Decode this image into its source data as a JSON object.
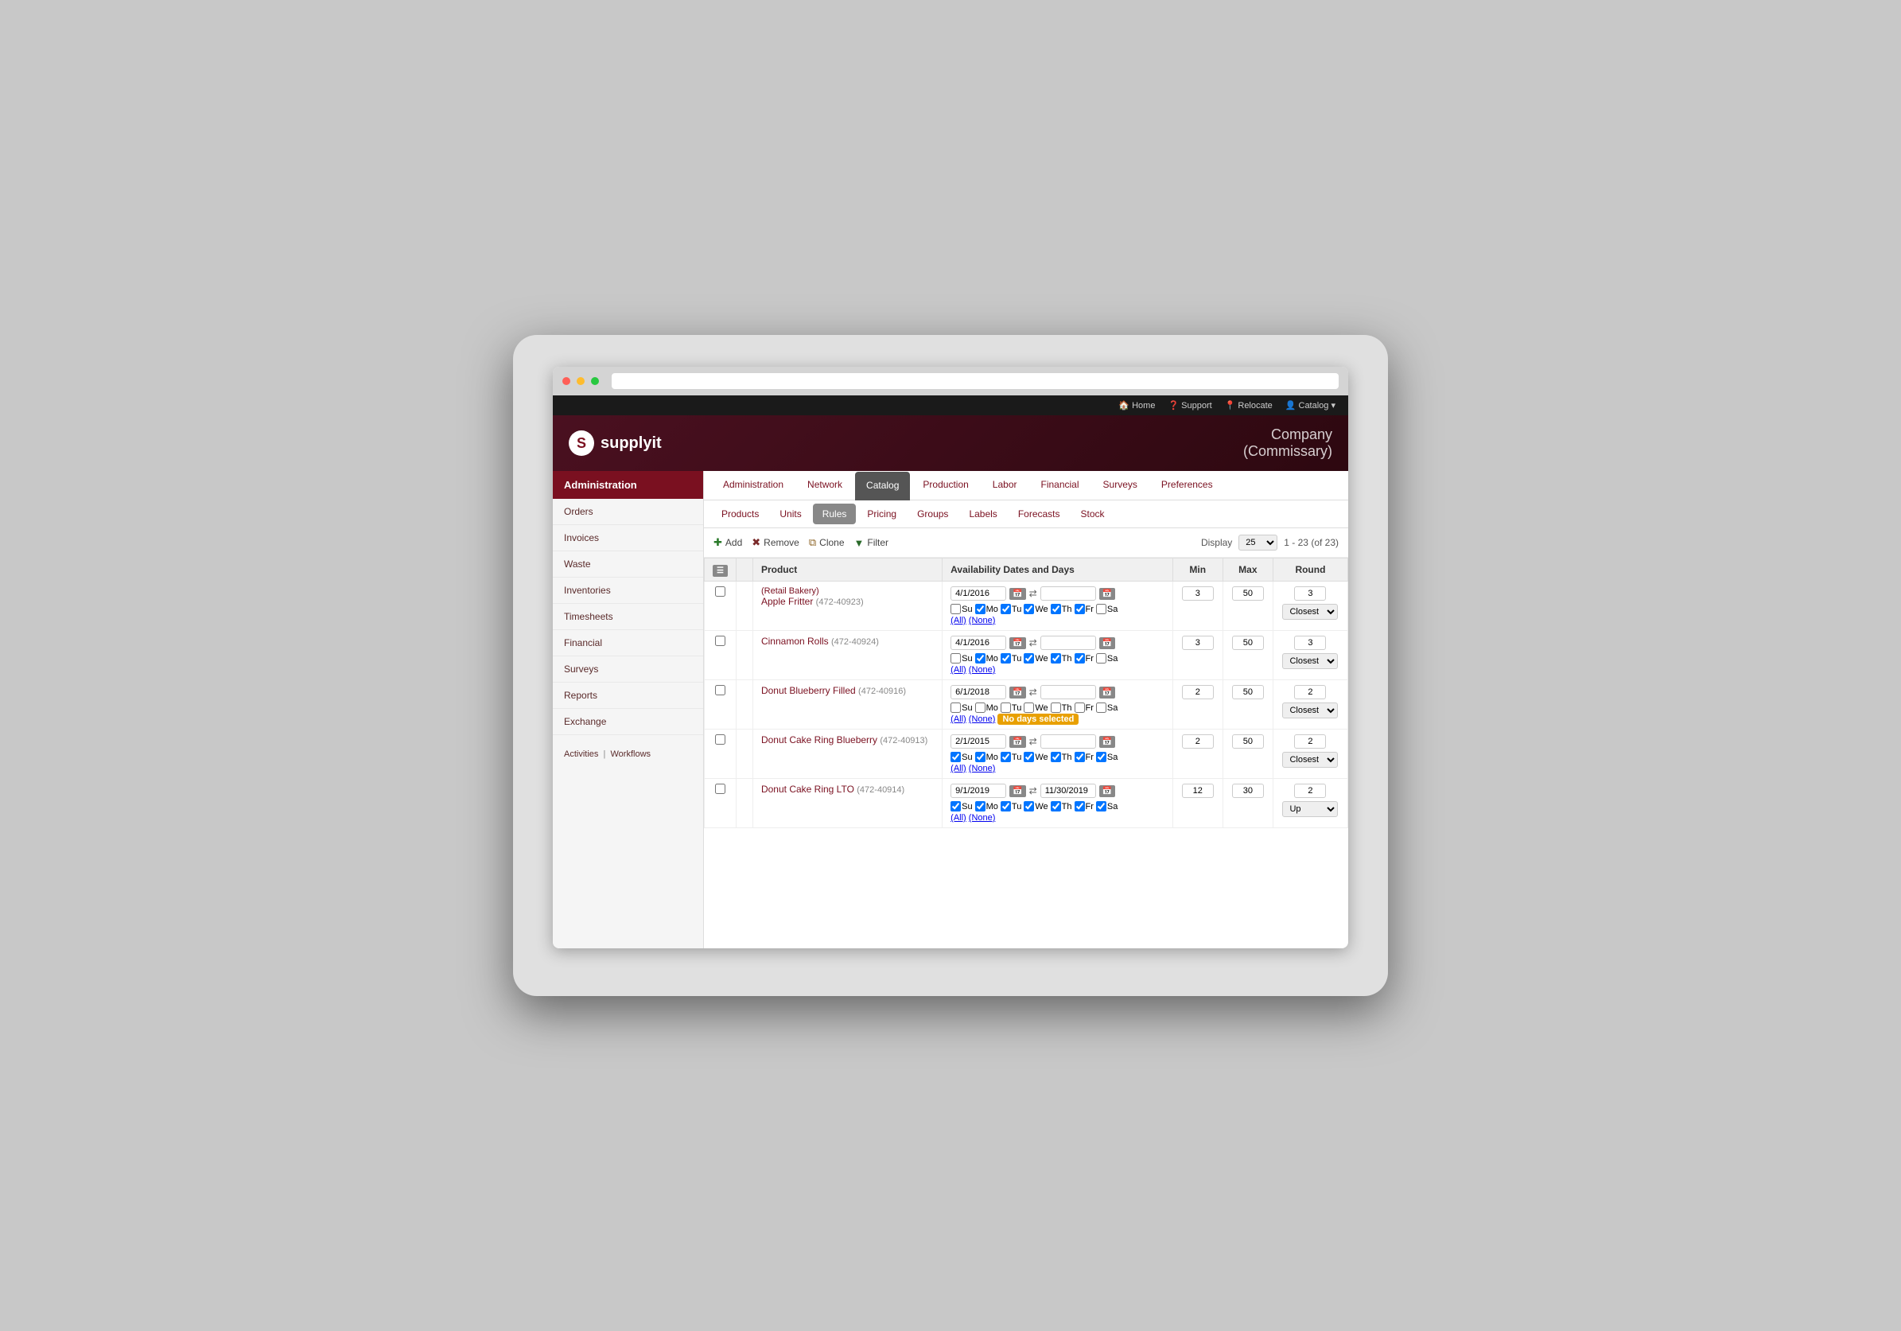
{
  "browser": {
    "dots": [
      "red",
      "yellow",
      "green"
    ]
  },
  "topnav": {
    "items": [
      {
        "label": "Home",
        "icon": "🏠"
      },
      {
        "label": "Support",
        "icon": "❓"
      },
      {
        "label": "Relocate",
        "icon": "📍"
      },
      {
        "label": "Catalog ▾",
        "icon": "👤"
      }
    ]
  },
  "header": {
    "logo_text": "supplyit",
    "company": "Company",
    "subtitle": "(Commissary)"
  },
  "sidebar": {
    "active_item": "Administration",
    "items": [
      {
        "label": "Orders"
      },
      {
        "label": "Invoices"
      },
      {
        "label": "Waste"
      },
      {
        "label": "Inventories"
      },
      {
        "label": "Timesheets"
      },
      {
        "label": "Financial"
      },
      {
        "label": "Surveys"
      },
      {
        "label": "Reports"
      },
      {
        "label": "Exchange"
      }
    ],
    "footer_links": [
      "Activities",
      "Workflows"
    ]
  },
  "tabs": {
    "main": [
      {
        "label": "Administration"
      },
      {
        "label": "Network"
      },
      {
        "label": "Catalog",
        "active": true
      },
      {
        "label": "Production"
      },
      {
        "label": "Labor"
      },
      {
        "label": "Financial"
      },
      {
        "label": "Surveys"
      },
      {
        "label": "Preferences"
      }
    ],
    "sub": [
      {
        "label": "Products"
      },
      {
        "label": "Units"
      },
      {
        "label": "Rules",
        "active": true
      },
      {
        "label": "Pricing"
      },
      {
        "label": "Groups"
      },
      {
        "label": "Labels"
      },
      {
        "label": "Forecasts"
      },
      {
        "label": "Stock"
      }
    ]
  },
  "toolbar": {
    "add_label": "Add",
    "remove_label": "Remove",
    "clone_label": "Clone",
    "filter_label": "Filter",
    "display_label": "Display",
    "display_value": "25",
    "pagination": "1 - 23 (of 23)"
  },
  "table": {
    "headers": [
      "",
      "",
      "Product",
      "Availability Dates and Days",
      "Min",
      "Max",
      "Round"
    ],
    "rows": [
      {
        "id": 1,
        "category": "Retail Bakery",
        "product_name": "Apple Fritter",
        "product_code": "472-40923",
        "date_from": "4/1/2016",
        "date_to": "",
        "min": "3",
        "max": "50",
        "round_val": "3",
        "round_type": "Closest",
        "days": [
          {
            "label": "Su",
            "checked": false
          },
          {
            "label": "Mo",
            "checked": true
          },
          {
            "label": "Tu",
            "checked": true
          },
          {
            "label": "We",
            "checked": true
          },
          {
            "label": "Th",
            "checked": true
          },
          {
            "label": "Fr",
            "checked": true
          },
          {
            "label": "Sa",
            "checked": false
          }
        ],
        "warning": ""
      },
      {
        "id": 2,
        "category": "",
        "product_name": "Cinnamon Rolls",
        "product_code": "472-40924",
        "date_from": "4/1/2016",
        "date_to": "",
        "min": "3",
        "max": "50",
        "round_val": "3",
        "round_type": "Closest",
        "days": [
          {
            "label": "Su",
            "checked": false
          },
          {
            "label": "Mo",
            "checked": true
          },
          {
            "label": "Tu",
            "checked": true
          },
          {
            "label": "We",
            "checked": true
          },
          {
            "label": "Th",
            "checked": true
          },
          {
            "label": "Fr",
            "checked": true
          },
          {
            "label": "Sa",
            "checked": false
          }
        ],
        "warning": ""
      },
      {
        "id": 3,
        "category": "",
        "product_name": "Donut Blueberry Filled",
        "product_code": "472-40916",
        "date_from": "6/1/2018",
        "date_to": "",
        "min": "2",
        "max": "50",
        "round_val": "2",
        "round_type": "Closest",
        "days": [
          {
            "label": "Su",
            "checked": false
          },
          {
            "label": "Mo",
            "checked": false
          },
          {
            "label": "Tu",
            "checked": false
          },
          {
            "label": "We",
            "checked": false
          },
          {
            "label": "Th",
            "checked": false
          },
          {
            "label": "Fr",
            "checked": false
          },
          {
            "label": "Sa",
            "checked": false
          }
        ],
        "warning": "No days selected"
      },
      {
        "id": 4,
        "category": "",
        "product_name": "Donut Cake Ring Blueberry",
        "product_code": "472-40913",
        "date_from": "2/1/2015",
        "date_to": "",
        "min": "2",
        "max": "50",
        "round_val": "2",
        "round_type": "Closest",
        "days": [
          {
            "label": "Su",
            "checked": true
          },
          {
            "label": "Mo",
            "checked": true
          },
          {
            "label": "Tu",
            "checked": true
          },
          {
            "label": "We",
            "checked": true
          },
          {
            "label": "Th",
            "checked": true
          },
          {
            "label": "Fr",
            "checked": true
          },
          {
            "label": "Sa",
            "checked": true
          }
        ],
        "warning": ""
      },
      {
        "id": 5,
        "category": "",
        "product_name": "Donut Cake Ring LTO",
        "product_code": "472-40914",
        "date_from": "9/1/2019",
        "date_to": "11/30/2019",
        "min": "12",
        "max": "30",
        "round_val": "2",
        "round_type": "Up",
        "days": [
          {
            "label": "Su",
            "checked": true
          },
          {
            "label": "Mo",
            "checked": true
          },
          {
            "label": "Tu",
            "checked": true
          },
          {
            "label": "We",
            "checked": true
          },
          {
            "label": "Th",
            "checked": true
          },
          {
            "label": "Fr",
            "checked": true
          },
          {
            "label": "Sa",
            "checked": true
          }
        ],
        "warning": ""
      }
    ]
  }
}
